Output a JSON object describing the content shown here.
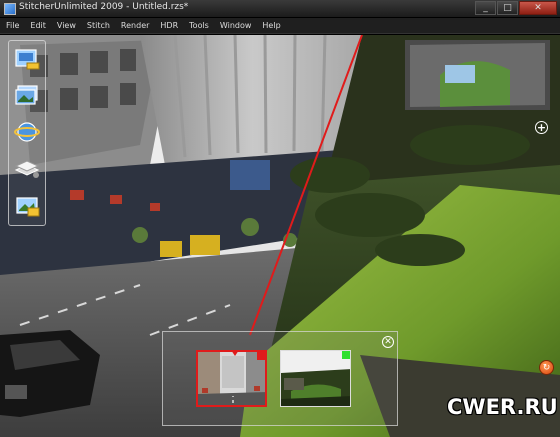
{
  "window": {
    "title": "StitcherUnlimited 2009 - Untitled.rzs*",
    "buttons": {
      "minimize": "_",
      "maximize": "□",
      "close": "✕"
    }
  },
  "menu": {
    "items": [
      "File",
      "Edit",
      "View",
      "Stitch",
      "Render",
      "HDR",
      "Tools",
      "Window",
      "Help"
    ]
  },
  "palette": {
    "tools": [
      {
        "icon": "import-images-icon"
      },
      {
        "icon": "image-list-icon"
      },
      {
        "icon": "globe-icon"
      },
      {
        "icon": "stitch-layers-icon"
      },
      {
        "icon": "export-image-icon"
      }
    ]
  },
  "navigation": {
    "plus_icon": "+"
  },
  "thumbnail_panel": {
    "close_icon": "✕",
    "thumbnails": [
      {
        "name": "street-scene",
        "selected": true,
        "marker_color": "#e01b1b"
      },
      {
        "name": "garden-scene",
        "selected": false,
        "marker_color": "#2ee02e"
      }
    ]
  },
  "fx_button": "↻",
  "watermark": "CWER.RU",
  "colors": {
    "seam": "#e01b1b",
    "selection": "#e01b1b",
    "marker_green": "#2ee02e",
    "accent": "#d8440c"
  }
}
